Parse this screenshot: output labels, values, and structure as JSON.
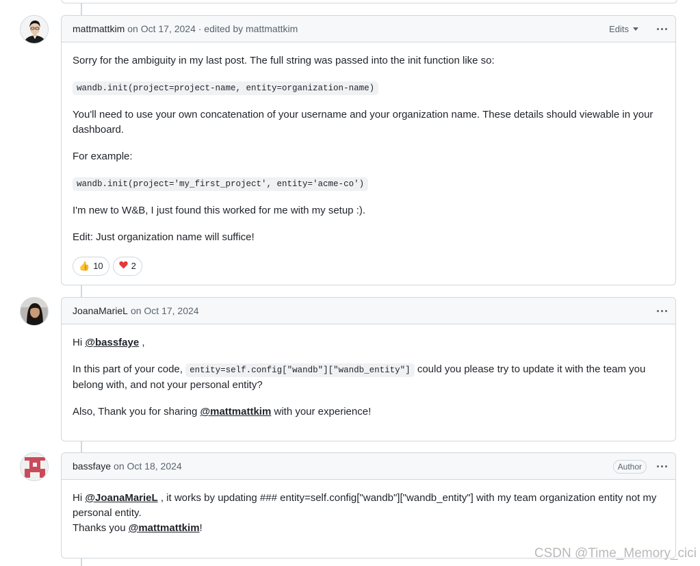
{
  "comments": [
    {
      "author": "mattmattkim",
      "date_text": "on Oct 17, 2024 · edited by mattmattkim",
      "edits_label": "Edits",
      "body": {
        "p1": "Sorry for the ambiguity in my last post. The full string was passed into the init function like so:",
        "code1": "wandb.init(project=project-name, entity=organization-name)",
        "p2": "You'll need to use your own concatenation of your username and your organization name. These details should viewable in your dashboard.",
        "p3": "For example:",
        "code2": "wandb.init(project='my_first_project', entity='acme-co')",
        "p4": "I'm new to W&B, I just found this worked for me with my setup :).",
        "p5": "Edit: Just organization name will suffice!"
      },
      "reactions": [
        {
          "emoji": "👍",
          "count": "10"
        },
        {
          "emoji": "❤️",
          "count": "2"
        }
      ]
    },
    {
      "author": "JoanaMarieL",
      "date_text": "on Oct 17, 2024",
      "body": {
        "hi": "Hi ",
        "mention1": "@bassfaye",
        "hi_end": " ,",
        "p2a": "In this part of your code, ",
        "code": "entity=self.config[\"wandb\"][\"wandb_entity\"]",
        "p2b": " could you please try to update it with the team you belong with, and not your personal entity?",
        "p3a": "Also, Thank you for sharing ",
        "mention2": "@mattmattkim",
        "p3b": " with your experience!"
      }
    },
    {
      "author": "bassfaye",
      "date_text": "on Oct 18, 2024",
      "badge": "Author",
      "body": {
        "hi": "Hi ",
        "mention1": "@JoanaMarieL",
        "text1": " , it works by updating ### entity=self.config[\"wandb\"][\"wandb_entity\"] with my team organization entity not my personal entity.",
        "thanks": "Thanks you ",
        "mention2": "@mattmattkim",
        "excl": "!"
      }
    }
  ],
  "watermark": "CSDN @Time_Memory_cici",
  "colors": {
    "border": "#d0d7de",
    "header_bg": "#f6f8fa",
    "muted": "#59636e",
    "heart": "#e5383b"
  }
}
